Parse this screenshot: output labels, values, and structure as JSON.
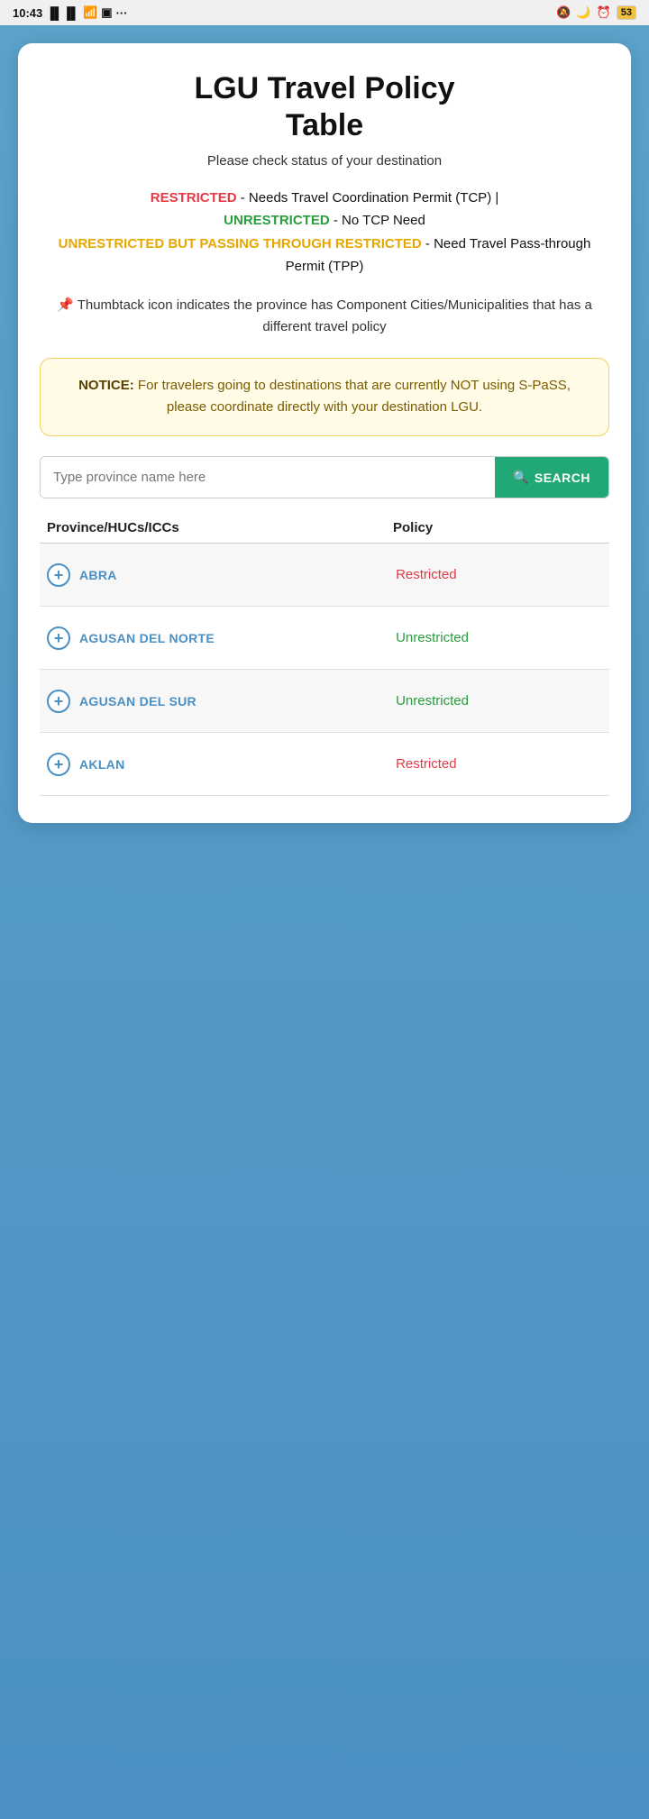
{
  "statusBar": {
    "time": "10:43",
    "battery": "53"
  },
  "header": {
    "title": "LGU Travel Policy\nTable",
    "subtitle": "Please check status of your destination"
  },
  "legend": {
    "restricted_label": "RESTRICTED",
    "restricted_desc": " - Needs Travel Coordination Permit (TCP) | ",
    "unrestricted_label": "UNRESTRICTED",
    "unrestricted_desc": " - No TCP Need",
    "through_label": "UNRESTRICTED BUT PASSING THROUGH RESTRICTED",
    "through_desc": " - Need Travel Pass-through Permit (TPP)"
  },
  "thumbtack_note": "📌 Thumbtack icon indicates the province has Component Cities/Municipalities that has a different travel policy",
  "notice": {
    "label": "NOTICE:",
    "text": " For travelers going to destinations that are currently NOT using S-PaSS, please coordinate directly with your destination LGU."
  },
  "search": {
    "placeholder": "Type province name here",
    "button_label": "SEARCH"
  },
  "table": {
    "col_province": "Province/HUCs/ICCs",
    "col_policy": "Policy",
    "rows": [
      {
        "name": "ABRA",
        "policy": "Restricted",
        "policy_type": "restricted"
      },
      {
        "name": "AGUSAN DEL NORTE",
        "policy": "Unrestricted",
        "policy_type": "unrestricted"
      },
      {
        "name": "AGUSAN DEL SUR",
        "policy": "Unrestricted",
        "policy_type": "unrestricted"
      },
      {
        "name": "AKLAN",
        "policy": "Restricted",
        "policy_type": "restricted"
      }
    ]
  }
}
